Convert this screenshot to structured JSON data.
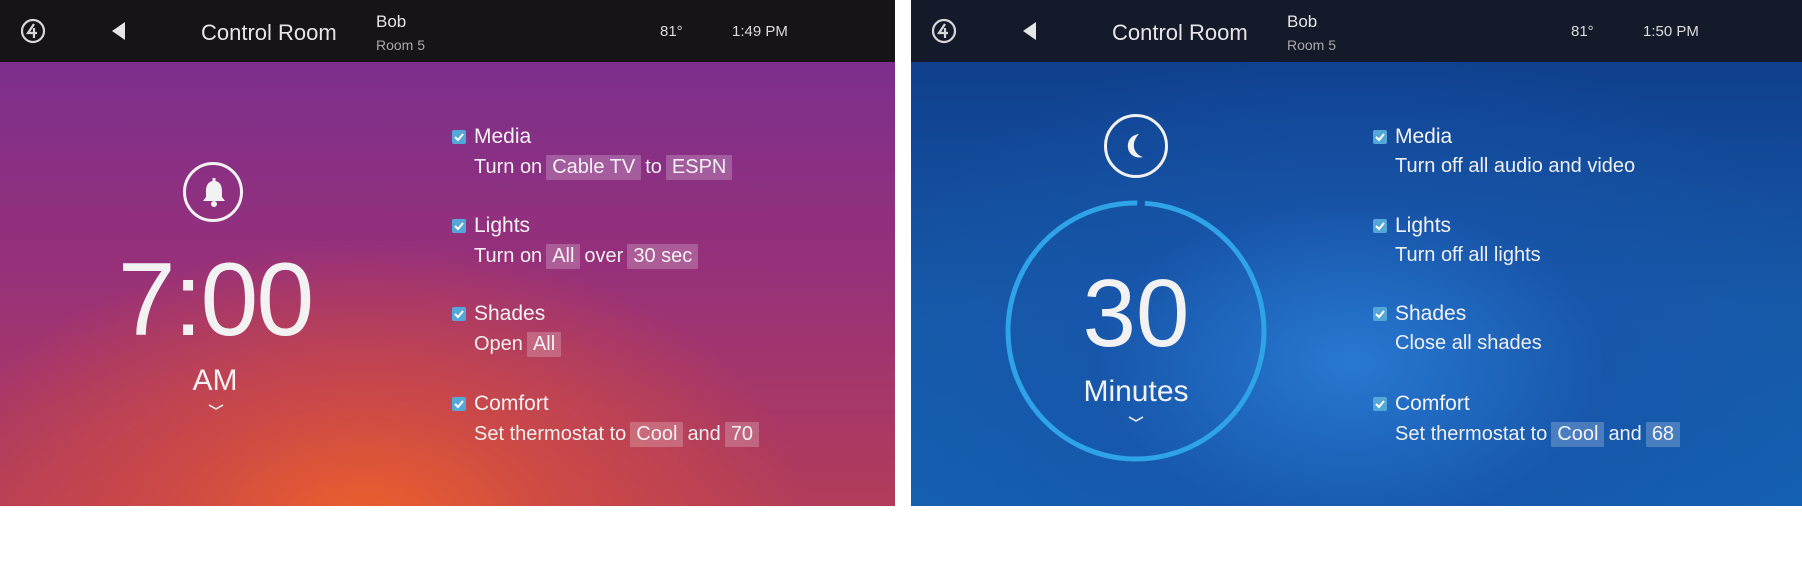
{
  "panels": [
    {
      "header": {
        "title": "Control Room",
        "user": "Bob",
        "room": "Room 5",
        "temperature": "81°",
        "time": "1:49 PM"
      },
      "scene_icon": "bell-icon",
      "main_value": "7:00",
      "main_sub": "AM",
      "items": [
        {
          "name": "Media",
          "checked": true,
          "parts": [
            {
              "text": "Turn on"
            },
            {
              "text": "Cable TV",
              "chip": true
            },
            {
              "text": "to"
            },
            {
              "text": "ESPN",
              "chip": true
            }
          ]
        },
        {
          "name": "Lights",
          "checked": true,
          "parts": [
            {
              "text": "Turn on"
            },
            {
              "text": "All",
              "chip": true
            },
            {
              "text": "over"
            },
            {
              "text": "30 sec",
              "chip": true
            }
          ]
        },
        {
          "name": "Shades",
          "checked": true,
          "parts": [
            {
              "text": "Open"
            },
            {
              "text": "All",
              "chip": true
            }
          ]
        },
        {
          "name": "Comfort",
          "checked": true,
          "parts": [
            {
              "text": "Set thermostat to"
            },
            {
              "text": "Cool",
              "chip": true
            },
            {
              "text": "and"
            },
            {
              "text": "70",
              "chip": true
            }
          ]
        }
      ]
    },
    {
      "header": {
        "title": "Control Room",
        "user": "Bob",
        "room": "Room 5",
        "temperature": "81°",
        "time": "1:50 PM"
      },
      "scene_icon": "moon-icon",
      "main_value": "30",
      "main_sub": "Minutes",
      "timer_progress": 0.99,
      "items": [
        {
          "name": "Media",
          "checked": true,
          "parts": [
            {
              "text": "Turn off all audio and video"
            }
          ]
        },
        {
          "name": "Lights",
          "checked": true,
          "parts": [
            {
              "text": "Turn off all lights"
            }
          ]
        },
        {
          "name": "Shades",
          "checked": true,
          "parts": [
            {
              "text": "Close all shades"
            }
          ]
        },
        {
          "name": "Comfort",
          "checked": true,
          "parts": [
            {
              "text": "Set thermostat to"
            },
            {
              "text": "Cool",
              "chip": true
            },
            {
              "text": "and"
            },
            {
              "text": "68",
              "chip": true
            }
          ]
        }
      ]
    }
  ],
  "colors": {
    "accent": "#54a8d8",
    "ring": "#2ea3e8"
  }
}
